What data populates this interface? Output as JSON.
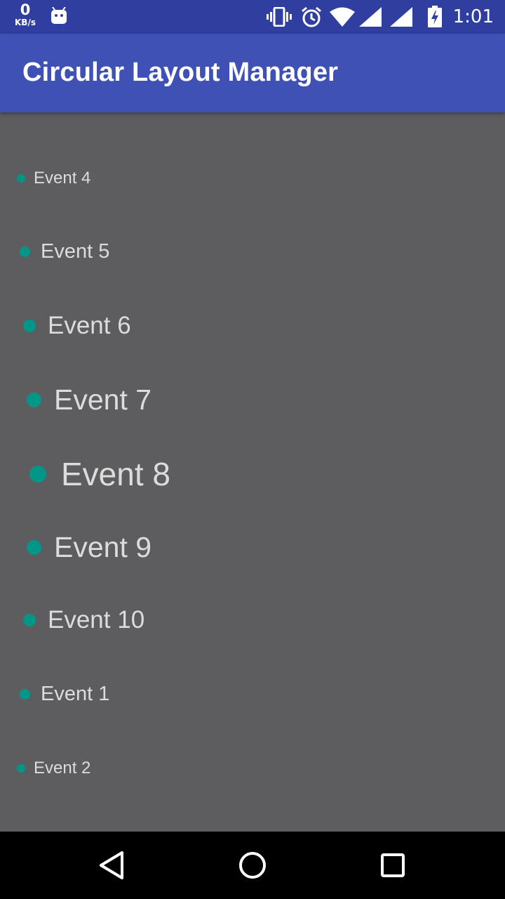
{
  "status_bar": {
    "net_speed_value": "0",
    "net_speed_unit": "KB/s",
    "time": "1:01",
    "icons": [
      "android-icon",
      "vibrate-icon",
      "alarm-icon",
      "wifi-icon",
      "signal-icon",
      "signal-icon",
      "battery-charging-icon"
    ]
  },
  "app_bar": {
    "title": "Circular Layout Manager"
  },
  "events": [
    {
      "label": "Event 4"
    },
    {
      "label": "Event 5"
    },
    {
      "label": "Event 6"
    },
    {
      "label": "Event 7"
    },
    {
      "label": "Event 8"
    },
    {
      "label": "Event 9"
    },
    {
      "label": "Event 10"
    },
    {
      "label": "Event 1"
    },
    {
      "label": "Event 2"
    }
  ],
  "nav_bar": {
    "icons": [
      "back-icon",
      "home-icon",
      "recents-icon"
    ]
  },
  "colors": {
    "status_bar": "#303f9f",
    "app_bar": "#3f51b5",
    "background": "#5d5d5f",
    "dot": "#009688",
    "text": "#dcdcdc"
  }
}
